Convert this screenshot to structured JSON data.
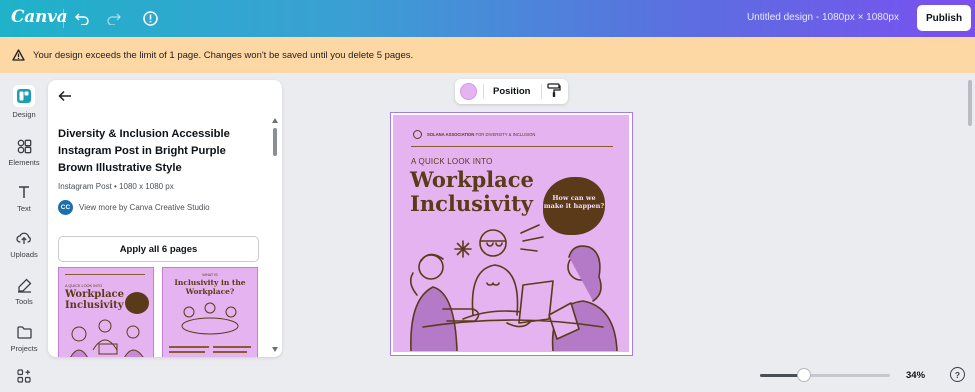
{
  "app": {
    "logo": "Canva",
    "doc_title": "Untitled design - 1080px × 1080px",
    "publish_label": "Publish"
  },
  "banner": {
    "text": "Your design exceeds the limit of 1 page. Changes won't be saved until you delete 5 pages."
  },
  "rail": {
    "items": [
      {
        "label": "Design",
        "icon": "layout-icon"
      },
      {
        "label": "Elements",
        "icon": "shapes-icon"
      },
      {
        "label": "Text",
        "icon": "text-icon"
      },
      {
        "label": "Uploads",
        "icon": "cloud-upload-icon"
      },
      {
        "label": "Tools",
        "icon": "draw-icon"
      },
      {
        "label": "Projects",
        "icon": "folder-icon"
      }
    ]
  },
  "panel": {
    "title": "Diversity & Inclusion Accessible Instagram Post in Bright Purple Brown Illustrative Style",
    "meta": "Instagram Post • 1080 x 1080 px",
    "creator_initials": "CC",
    "creator_text": "View more by Canva Creative Studio",
    "apply_label": "Apply all 6 pages",
    "thumbs": [
      {
        "line1": "A QUICK LOOK INTO",
        "line2": "Workplace",
        "line3": "Inclusivity"
      },
      {
        "line1": "WHAT IS",
        "line2": "Inclusivity in the",
        "line3": "Workplace?"
      }
    ]
  },
  "context_toolbar": {
    "position_label": "Position",
    "swatch_color": "#e6b3f2"
  },
  "design": {
    "org_bold": "SOLANA ASSOCIATION",
    "org_rest": "FOR DIVERSITY & INCLUSION",
    "pre_headline": "A QUICK LOOK INTO",
    "headline": "Workplace Inclusivity",
    "bubble": "How can we make it happen?",
    "background": "#e5b3f0",
    "ink": "#5b3a1a"
  },
  "zoom": {
    "label": "34%",
    "value": 0.34
  },
  "help_label": "?"
}
